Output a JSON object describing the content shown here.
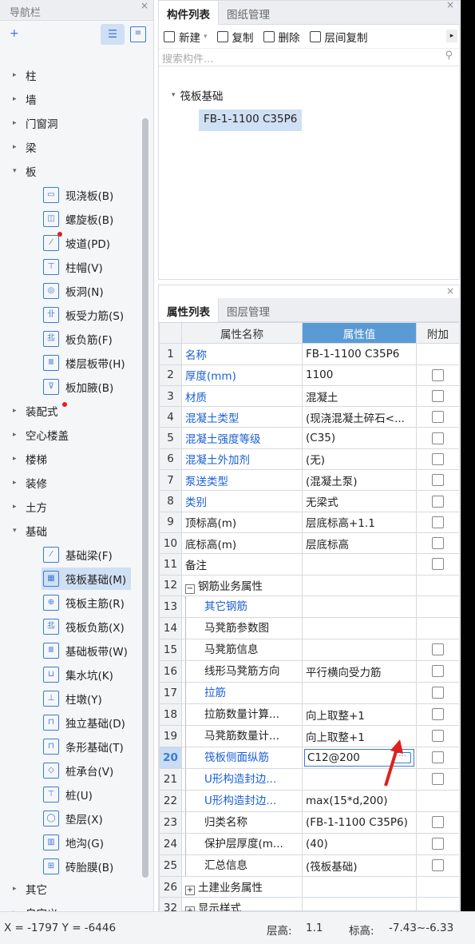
{
  "nav": {
    "title": "导航栏",
    "close": "×",
    "items": [
      {
        "label": "柱",
        "arrow": "▸"
      },
      {
        "label": "墙",
        "arrow": "▸"
      },
      {
        "label": "门窗洞",
        "arrow": "▸"
      },
      {
        "label": "梁",
        "arrow": "▸"
      },
      {
        "label": "板",
        "arrow": "▾"
      },
      {
        "label": "装配式",
        "arrow": "▸"
      },
      {
        "label": "空心楼盖",
        "arrow": "▸"
      },
      {
        "label": "楼梯",
        "arrow": "▸"
      },
      {
        "label": "装修",
        "arrow": "▸"
      },
      {
        "label": "土方",
        "arrow": "▸"
      },
      {
        "label": "基础",
        "arrow": "▾"
      },
      {
        "label": "其它",
        "arrow": "▸"
      },
      {
        "label": "自定义",
        "arrow": "▸"
      }
    ],
    "slab_items": [
      {
        "label": "现浇板(B)",
        "icon": "cast-slab-icon"
      },
      {
        "label": "螺旋板(B)",
        "icon": "spiral-slab-icon"
      },
      {
        "label": "坡道(PD)",
        "icon": "ramp-icon"
      },
      {
        "label": "柱帽(V)",
        "icon": "column-cap-icon"
      },
      {
        "label": "板洞(N)",
        "icon": "slab-hole-icon"
      },
      {
        "label": "板受力筋(S)",
        "icon": "slab-main-rebar-icon"
      },
      {
        "label": "板负筋(F)",
        "icon": "slab-neg-rebar-icon"
      },
      {
        "label": "楼层板带(H)",
        "icon": "floor-strip-icon"
      },
      {
        "label": "板加腋(B)",
        "icon": "slab-haunch-icon"
      }
    ],
    "found_items": [
      {
        "label": "基础梁(F)",
        "icon": "foundation-beam-icon"
      },
      {
        "label": "筏板基础(M)",
        "icon": "raft-foundation-icon"
      },
      {
        "label": "筏板主筋(R)",
        "icon": "raft-main-rebar-icon"
      },
      {
        "label": "筏板负筋(X)",
        "icon": "raft-neg-rebar-icon"
      },
      {
        "label": "基础板带(W)",
        "icon": "foundation-strip-icon"
      },
      {
        "label": "集水坑(K)",
        "icon": "sump-icon"
      },
      {
        "label": "柱墩(Y)",
        "icon": "column-pier-icon"
      },
      {
        "label": "独立基础(D)",
        "icon": "isolated-footing-icon"
      },
      {
        "label": "条形基础(T)",
        "icon": "strip-footing-icon"
      },
      {
        "label": "桩承台(V)",
        "icon": "pile-cap-icon"
      },
      {
        "label": "桩(U)",
        "icon": "pile-icon"
      },
      {
        "label": "垫层(X)",
        "icon": "cushion-icon"
      },
      {
        "label": "地沟(G)",
        "icon": "trench-icon"
      },
      {
        "label": "砖胎膜(B)",
        "icon": "brick-mold-icon"
      }
    ]
  },
  "components": {
    "tabs": [
      "构件列表",
      "图纸管理"
    ],
    "toolbar": {
      "new": "新建",
      "copy": "复制",
      "delete": "删除",
      "floor_copy": "层间复制"
    },
    "search_placeholder": "搜索构件...",
    "tree_root": "筏板基础",
    "tree_child": "FB-1-1100 C35P6"
  },
  "props": {
    "tabs": [
      "属性列表",
      "图层管理"
    ],
    "headers": {
      "name": "属性名称",
      "value": "属性值",
      "extra": "附加"
    },
    "rows": [
      {
        "n": "1",
        "name": "名称",
        "value": "FB-1-1100 C35P6"
      },
      {
        "n": "2",
        "name": "厚度(mm)",
        "value": "1100"
      },
      {
        "n": "3",
        "name": "材质",
        "value": "混凝土"
      },
      {
        "n": "4",
        "name": "混凝土类型",
        "value": "(现浇混凝土碎石<..."
      },
      {
        "n": "5",
        "name": "混凝土强度等级",
        "value": "(C35)"
      },
      {
        "n": "6",
        "name": "混凝土外加剂",
        "value": "(无)"
      },
      {
        "n": "7",
        "name": "泵送类型",
        "value": "(混凝土泵)"
      },
      {
        "n": "8",
        "name": "类别",
        "value": "无梁式"
      },
      {
        "n": "9",
        "name": "顶标高(m)",
        "value": "层底标高+1.1"
      },
      {
        "n": "10",
        "name": "底标高(m)",
        "value": "层底标高"
      },
      {
        "n": "11",
        "name": "备注",
        "value": ""
      },
      {
        "n": "12",
        "name": "钢筋业务属性",
        "value": ""
      },
      {
        "n": "13",
        "name": "其它钢筋",
        "value": ""
      },
      {
        "n": "14",
        "name": "马凳筋参数图",
        "value": ""
      },
      {
        "n": "15",
        "name": "马凳筋信息",
        "value": ""
      },
      {
        "n": "16",
        "name": "线形马凳筋方向",
        "value": "平行横向受力筋"
      },
      {
        "n": "17",
        "name": "拉筋",
        "value": ""
      },
      {
        "n": "18",
        "name": "拉筋数量计算...",
        "value": "向上取整+1"
      },
      {
        "n": "19",
        "name": "马凳筋数量计...",
        "value": "向上取整+1"
      },
      {
        "n": "20",
        "name": "筏板侧面纵筋",
        "value": "C12@200"
      },
      {
        "n": "21",
        "name": "U形构造封边...",
        "value": ""
      },
      {
        "n": "22",
        "name": "U形构造封边...",
        "value": "max(15*d,200)"
      },
      {
        "n": "23",
        "name": "归类名称",
        "value": "(FB-1-1100 C35P6)"
      },
      {
        "n": "24",
        "name": "保护层厚度(m...",
        "value": "(40)"
      },
      {
        "n": "25",
        "name": "汇总信息",
        "value": "(筏板基础)"
      },
      {
        "n": "26",
        "name": "土建业务属性",
        "value": ""
      },
      {
        "n": "32",
        "name": "显示样式",
        "value": ""
      }
    ]
  },
  "status": {
    "coords": "X = -1797 Y = -6446",
    "floor_h_label": "层高:",
    "floor_h": "1.1",
    "elev_label": "标高:",
    "elev": "-7.43~-6.33"
  }
}
